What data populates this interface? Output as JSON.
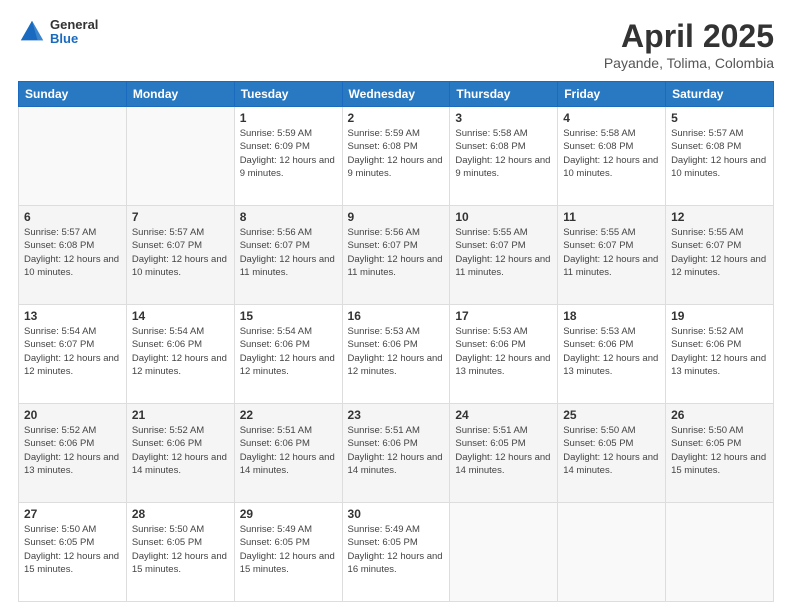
{
  "header": {
    "logo_general": "General",
    "logo_blue": "Blue",
    "title": "April 2025",
    "subtitle": "Payande, Tolima, Colombia"
  },
  "weekdays": [
    "Sunday",
    "Monday",
    "Tuesday",
    "Wednesday",
    "Thursday",
    "Friday",
    "Saturday"
  ],
  "weeks": [
    [
      {
        "day": "",
        "info": ""
      },
      {
        "day": "",
        "info": ""
      },
      {
        "day": "1",
        "info": "Sunrise: 5:59 AM\nSunset: 6:09 PM\nDaylight: 12 hours and 9 minutes."
      },
      {
        "day": "2",
        "info": "Sunrise: 5:59 AM\nSunset: 6:08 PM\nDaylight: 12 hours and 9 minutes."
      },
      {
        "day": "3",
        "info": "Sunrise: 5:58 AM\nSunset: 6:08 PM\nDaylight: 12 hours and 9 minutes."
      },
      {
        "day": "4",
        "info": "Sunrise: 5:58 AM\nSunset: 6:08 PM\nDaylight: 12 hours and 10 minutes."
      },
      {
        "day": "5",
        "info": "Sunrise: 5:57 AM\nSunset: 6:08 PM\nDaylight: 12 hours and 10 minutes."
      }
    ],
    [
      {
        "day": "6",
        "info": "Sunrise: 5:57 AM\nSunset: 6:08 PM\nDaylight: 12 hours and 10 minutes."
      },
      {
        "day": "7",
        "info": "Sunrise: 5:57 AM\nSunset: 6:07 PM\nDaylight: 12 hours and 10 minutes."
      },
      {
        "day": "8",
        "info": "Sunrise: 5:56 AM\nSunset: 6:07 PM\nDaylight: 12 hours and 11 minutes."
      },
      {
        "day": "9",
        "info": "Sunrise: 5:56 AM\nSunset: 6:07 PM\nDaylight: 12 hours and 11 minutes."
      },
      {
        "day": "10",
        "info": "Sunrise: 5:55 AM\nSunset: 6:07 PM\nDaylight: 12 hours and 11 minutes."
      },
      {
        "day": "11",
        "info": "Sunrise: 5:55 AM\nSunset: 6:07 PM\nDaylight: 12 hours and 11 minutes."
      },
      {
        "day": "12",
        "info": "Sunrise: 5:55 AM\nSunset: 6:07 PM\nDaylight: 12 hours and 12 minutes."
      }
    ],
    [
      {
        "day": "13",
        "info": "Sunrise: 5:54 AM\nSunset: 6:07 PM\nDaylight: 12 hours and 12 minutes."
      },
      {
        "day": "14",
        "info": "Sunrise: 5:54 AM\nSunset: 6:06 PM\nDaylight: 12 hours and 12 minutes."
      },
      {
        "day": "15",
        "info": "Sunrise: 5:54 AM\nSunset: 6:06 PM\nDaylight: 12 hours and 12 minutes."
      },
      {
        "day": "16",
        "info": "Sunrise: 5:53 AM\nSunset: 6:06 PM\nDaylight: 12 hours and 12 minutes."
      },
      {
        "day": "17",
        "info": "Sunrise: 5:53 AM\nSunset: 6:06 PM\nDaylight: 12 hours and 13 minutes."
      },
      {
        "day": "18",
        "info": "Sunrise: 5:53 AM\nSunset: 6:06 PM\nDaylight: 12 hours and 13 minutes."
      },
      {
        "day": "19",
        "info": "Sunrise: 5:52 AM\nSunset: 6:06 PM\nDaylight: 12 hours and 13 minutes."
      }
    ],
    [
      {
        "day": "20",
        "info": "Sunrise: 5:52 AM\nSunset: 6:06 PM\nDaylight: 12 hours and 13 minutes."
      },
      {
        "day": "21",
        "info": "Sunrise: 5:52 AM\nSunset: 6:06 PM\nDaylight: 12 hours and 14 minutes."
      },
      {
        "day": "22",
        "info": "Sunrise: 5:51 AM\nSunset: 6:06 PM\nDaylight: 12 hours and 14 minutes."
      },
      {
        "day": "23",
        "info": "Sunrise: 5:51 AM\nSunset: 6:06 PM\nDaylight: 12 hours and 14 minutes."
      },
      {
        "day": "24",
        "info": "Sunrise: 5:51 AM\nSunset: 6:05 PM\nDaylight: 12 hours and 14 minutes."
      },
      {
        "day": "25",
        "info": "Sunrise: 5:50 AM\nSunset: 6:05 PM\nDaylight: 12 hours and 14 minutes."
      },
      {
        "day": "26",
        "info": "Sunrise: 5:50 AM\nSunset: 6:05 PM\nDaylight: 12 hours and 15 minutes."
      }
    ],
    [
      {
        "day": "27",
        "info": "Sunrise: 5:50 AM\nSunset: 6:05 PM\nDaylight: 12 hours and 15 minutes."
      },
      {
        "day": "28",
        "info": "Sunrise: 5:50 AM\nSunset: 6:05 PM\nDaylight: 12 hours and 15 minutes."
      },
      {
        "day": "29",
        "info": "Sunrise: 5:49 AM\nSunset: 6:05 PM\nDaylight: 12 hours and 15 minutes."
      },
      {
        "day": "30",
        "info": "Sunrise: 5:49 AM\nSunset: 6:05 PM\nDaylight: 12 hours and 16 minutes."
      },
      {
        "day": "",
        "info": ""
      },
      {
        "day": "",
        "info": ""
      },
      {
        "day": "",
        "info": ""
      }
    ]
  ]
}
